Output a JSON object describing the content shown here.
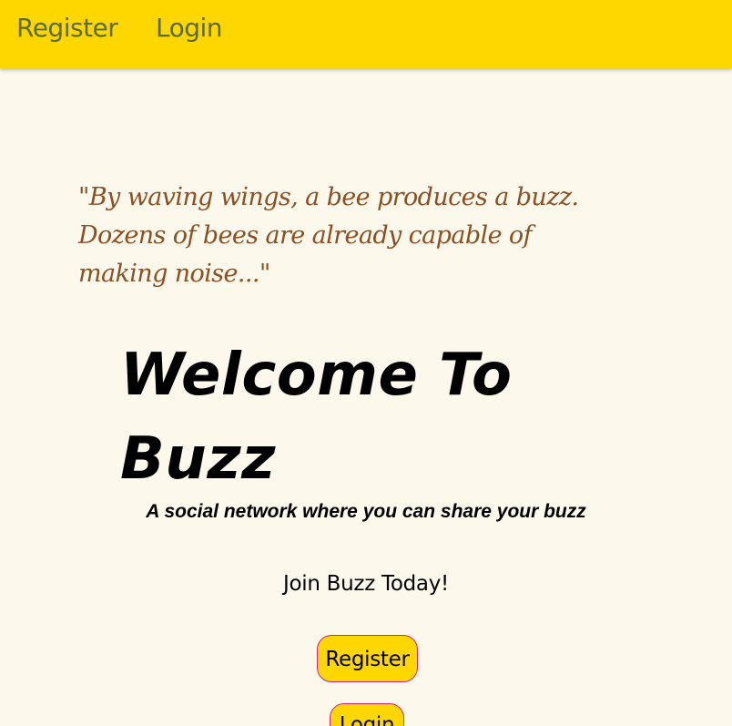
{
  "nav": {
    "register_label": "Register",
    "login_label": "Login"
  },
  "hero": {
    "quote": "\"By waving wings, a bee produces a buzz. Dozens of bees are already capable of making noise...\"",
    "welcome_title": "Welcome To Buzz",
    "tagline": "A social network where you can share your buzz",
    "join_text": "Join Buzz Today!",
    "register_button": "Register",
    "login_button": "Login"
  },
  "colors": {
    "header_bg": "#ffd700",
    "page_bg": "#fdf8ec",
    "nav_text": "#5c6a2e",
    "quote_text": "#8b4f22",
    "button_border": "#d4247a"
  }
}
